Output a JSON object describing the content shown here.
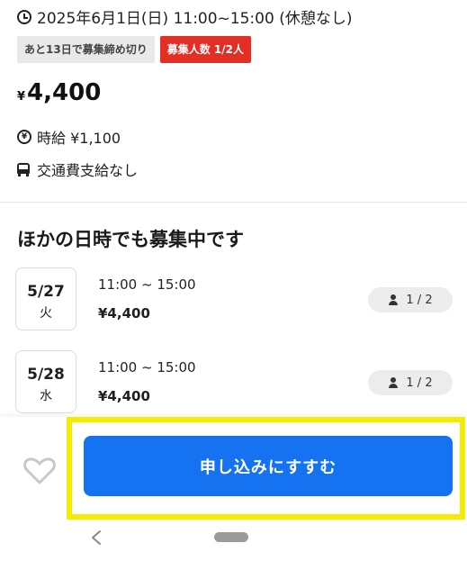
{
  "job": {
    "datetime": "2025年6月1日(日) 11:00~15:00 (休憩なし)",
    "deadline_badge": "あと13日で募集締め切り",
    "recruit_badge": "募集人数 1/2人",
    "price_yen_symbol": "¥",
    "price": "4,400",
    "hourly_wage": "時給 ¥1,100",
    "hourly_icon_text": "¥",
    "transport": "交通費支給なし"
  },
  "other_dates": {
    "title": "ほかの日時でも募集中です",
    "slots": [
      {
        "date": "5/27",
        "weekday": "火",
        "time": "11:00 ~ 15:00",
        "pay": "¥4,400",
        "capacity": "1 / 2"
      },
      {
        "date": "5/28",
        "weekday": "水",
        "time": "11:00 ~ 15:00",
        "pay": "¥4,400",
        "capacity": "1 / 2"
      }
    ]
  },
  "actions": {
    "apply_label": "申し込みにすすむ"
  },
  "colors": {
    "primary": "#1573f2",
    "recruit_badge": "#e12f25",
    "highlight": "#f5ec00"
  },
  "icons": {
    "clock": "clock-icon",
    "yen": "yen-coin-icon",
    "bus": "bus-icon",
    "person": "person-icon",
    "heart": "heart-outline-icon",
    "back": "chevron-left-icon"
  }
}
